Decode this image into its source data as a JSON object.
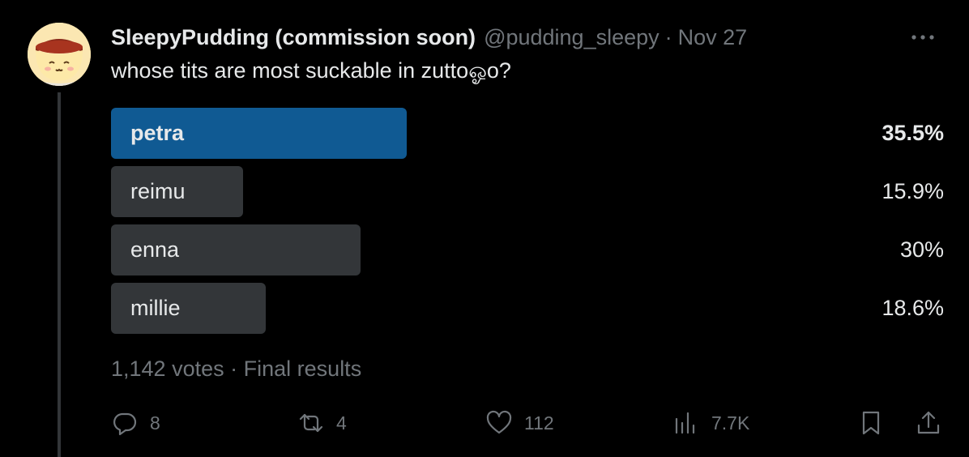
{
  "colors": {
    "background": "#000000",
    "winner_bar": "#105a93",
    "bar": "#333639",
    "muted": "#71767b",
    "text": "#e7e9ea"
  },
  "author": {
    "name": "SleepyPudding (commission soon)",
    "handle": "@pudding_sleepy",
    "separator": "·",
    "date": "Nov 27",
    "avatar_icon": "pudding-avatar"
  },
  "tweet": {
    "text": "whose tits are most suckable in zuttoஓo?"
  },
  "poll": {
    "options": [
      {
        "label": "petra",
        "percent_text": "35.5%",
        "share": 0.355,
        "winner": true
      },
      {
        "label": "reimu",
        "percent_text": "15.9%",
        "share": 0.159,
        "winner": false
      },
      {
        "label": "enna",
        "percent_text": "30%",
        "share": 0.3,
        "winner": false
      },
      {
        "label": "millie",
        "percent_text": "18.6%",
        "share": 0.186,
        "winner": false
      }
    ],
    "votes": "1,142 votes",
    "separator": "·",
    "status": "Final results"
  },
  "actions": {
    "reply": {
      "icon": "reply-icon",
      "count": "8"
    },
    "repost": {
      "icon": "repost-icon",
      "count": "4"
    },
    "like": {
      "icon": "heart-icon",
      "count": "112"
    },
    "views": {
      "icon": "views-icon",
      "count": "7.7K"
    },
    "bookmark": {
      "icon": "bookmark-icon"
    },
    "share": {
      "icon": "share-icon"
    }
  }
}
